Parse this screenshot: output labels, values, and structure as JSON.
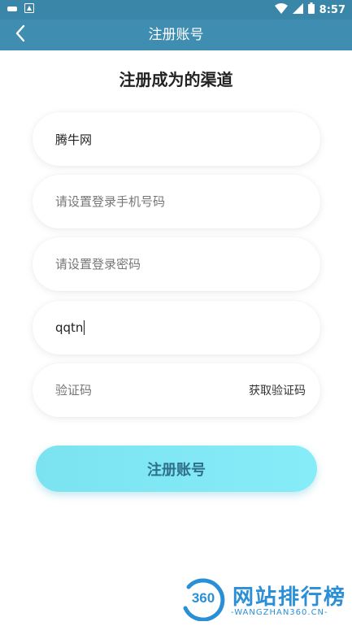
{
  "status_bar": {
    "time": "8:57",
    "icons": [
      "notification-icon",
      "app-icon",
      "wifi-icon",
      "signal-icon",
      "battery-icon"
    ]
  },
  "app_bar": {
    "title": "注册账号",
    "back_icon": "chevron-left-icon"
  },
  "page": {
    "heading": "注册成为的渠道"
  },
  "form": {
    "channel_name": {
      "value": "腾牛网",
      "placeholder": ""
    },
    "phone": {
      "value": "",
      "placeholder": "请设置登录手机号码"
    },
    "password": {
      "value": "",
      "placeholder": "请设置登录密码"
    },
    "invite": {
      "value": "qqtn",
      "placeholder": ""
    },
    "code": {
      "value": "",
      "placeholder": "验证码"
    },
    "get_code_label": "获取验证码",
    "submit_label": "注册账号"
  },
  "watermark": {
    "logo_text": "360",
    "title": "网站排行榜",
    "subtitle": "-WANGZHAN360.CN-"
  },
  "colors": {
    "status_bar": "#3a86a8",
    "app_bar": "#3f8db0",
    "button_start": "#7be3f0",
    "button_end": "#86ecf8",
    "button_text": "#2f6f8a",
    "watermark": "#2a8fd6"
  }
}
